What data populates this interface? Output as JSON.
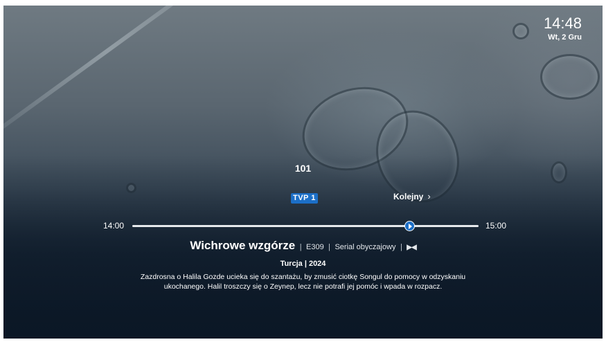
{
  "clock": {
    "time": "14:48",
    "date": "Wt, 2 Gru"
  },
  "channel": {
    "number": "101",
    "logo_text": "TVP 1"
  },
  "next": {
    "label": "Kolejny",
    "chevron": "›",
    "icon": "chevron-right-icon"
  },
  "timeline": {
    "start": "14:00",
    "end": "15:00",
    "progress": 0.8
  },
  "program": {
    "title": "Wichrowe wzgórze",
    "episode": "E309",
    "genre": "Serial obyczajowy",
    "separator": "|",
    "audio_description_icon": "audio-description-icon",
    "audio_description_glyph": "▶◀",
    "country_year": "Turcja | 2024",
    "description": "Zazdrosna o Halila Gozde ucieka się do szantażu, by zmusić ciotkę Songul do pomocy w odzyskaniu ukochanego. Halil troszczy się o Zeynep, lecz nie potrafi jej pomóc i wpada w rozpacz."
  },
  "colors": {
    "accent": "#1c6fc7",
    "text": "#ffffff",
    "background_dark": "#0f1c2c"
  }
}
